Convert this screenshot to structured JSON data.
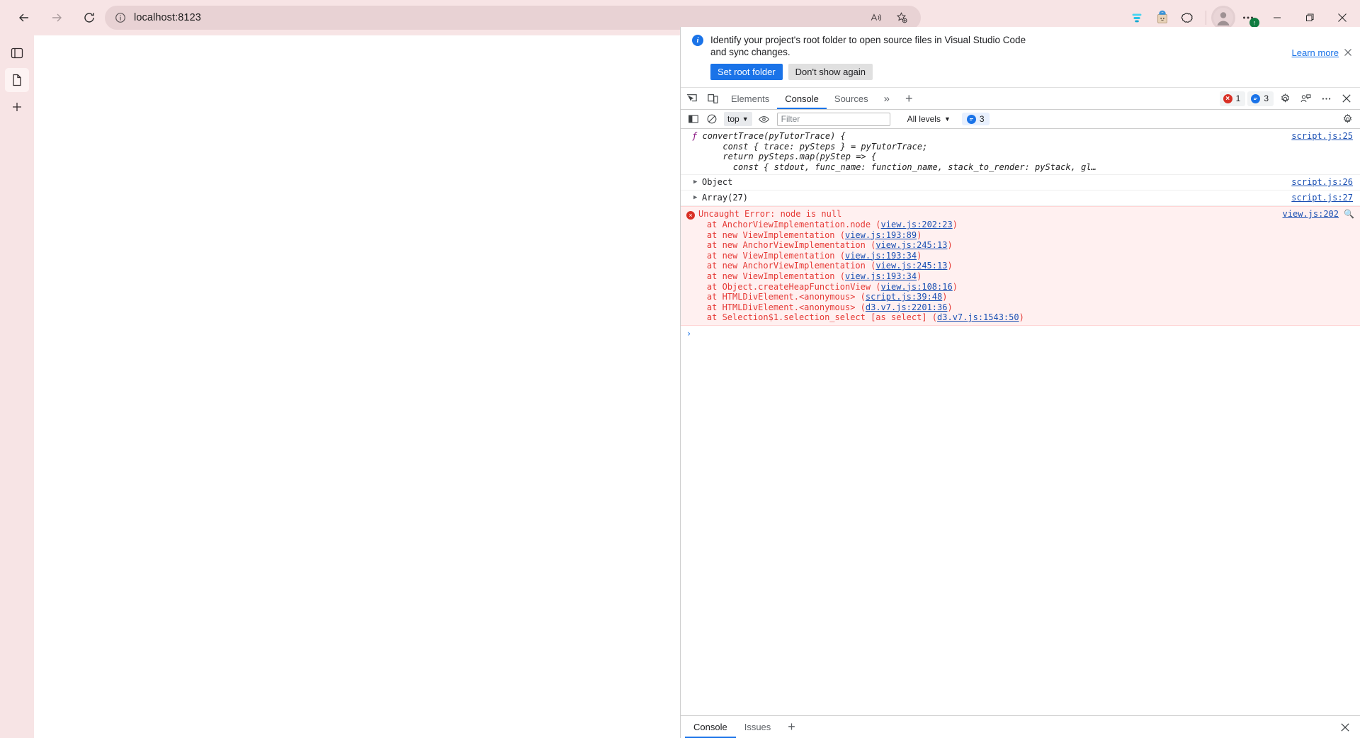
{
  "browser": {
    "back_label": "Back",
    "forward_label": "Forward",
    "refresh_label": "Refresh",
    "address": "localhost:8123",
    "info_icon": "site-info-icon",
    "read_aloud_label": "Read aloud",
    "favorite_label": "Add this page to favorites",
    "toolbar_icons": [
      {
        "name": "split-screen-icon",
        "label": "Split screen"
      },
      {
        "name": "shopping-bag-icon",
        "label": "Shopping"
      },
      {
        "name": "copilot-icon",
        "label": "Copilot"
      }
    ],
    "profile_label": "Profile",
    "settings_more_label": "Settings and more",
    "settings_badge": "↑",
    "minimize_label": "Minimize",
    "maximize_label": "Restore",
    "close_label": "Close",
    "accent": "#f7e4e5",
    "omnibox_bg": "#e8d2d4"
  },
  "left_rail": {
    "items": [
      {
        "name": "sidebar-item-copilot",
        "label": "Copilot"
      },
      {
        "name": "sidebar-item-page",
        "label": "Page",
        "active": true
      },
      {
        "name": "sidebar-item-add",
        "label": "Add tool"
      }
    ]
  },
  "devtools": {
    "infobar": {
      "icon": "info-icon",
      "text": "Identify your project's root folder to open source files in Visual Studio Code and sync changes.",
      "learn_more": "Learn more",
      "close_label": "Close",
      "primary_button": "Set root folder",
      "secondary_button": "Don't show again"
    },
    "tabbar": {
      "inspect_icon_label": "Inspect element",
      "device_icon_label": "Toggle device toolbar",
      "tabs": [
        {
          "label": "Elements",
          "active": false
        },
        {
          "label": "Console",
          "active": true
        },
        {
          "label": "Sources",
          "active": false
        }
      ],
      "more_tabs": "»",
      "add_tab": "+",
      "error_count": "1",
      "message_count": "3",
      "settings_label": "Settings",
      "feedback_label": "Send feedback",
      "more_label": "More options",
      "close_label": "Close DevTools"
    },
    "console_toolbar": {
      "sidebar_toggle_label": "Show console sidebar",
      "clear_label": "Clear console",
      "context_value": "top",
      "eye_label": "Create live expression",
      "filter_placeholder": "Filter",
      "filter_value": "",
      "levels_value": "All levels",
      "message_count": "3",
      "settings_label": "Console settings"
    },
    "logs": [
      {
        "type": "function",
        "kind_glyph": "ƒ",
        "lines": [
          "convertTrace(pyTutorTrace) {",
          "      const { trace: pySteps } = pyTutorTrace;",
          "      return pySteps.map(pyStep => {",
          "        const { stdout, func_name: function_name, stack_to_render: pyStack, gl…"
        ],
        "source": "script.js:25"
      },
      {
        "type": "object",
        "label": "Object",
        "disclosure": "▶",
        "source": "script.js:26"
      },
      {
        "type": "object",
        "label": "Array(27)",
        "disclosure": "▶",
        "source": "script.js:27"
      }
    ],
    "error": {
      "title": "Uncaught Error: node is null",
      "source": "view.js:202",
      "magnify_label": "Search for this message on the web",
      "stack": [
        {
          "text": "    at AnchorViewImplementation.node (",
          "link": "view.js:202:23",
          "suffix": ")"
        },
        {
          "text": "    at new ViewImplementation (",
          "link": "view.js:193:89",
          "suffix": ")"
        },
        {
          "text": "    at new AnchorViewImplementation (",
          "link": "view.js:245:13",
          "suffix": ")"
        },
        {
          "text": "    at new ViewImplementation (",
          "link": "view.js:193:34",
          "suffix": ")"
        },
        {
          "text": "    at new AnchorViewImplementation (",
          "link": "view.js:245:13",
          "suffix": ")"
        },
        {
          "text": "    at new ViewImplementation (",
          "link": "view.js:193:34",
          "suffix": ")"
        },
        {
          "text": "    at Object.createHeapFunctionView (",
          "link": "view.js:108:16",
          "suffix": ")"
        },
        {
          "text": "    at HTMLDivElement.<anonymous> (",
          "link": "script.js:39:48",
          "suffix": ")"
        },
        {
          "text": "    at HTMLDivElement.<anonymous> (",
          "link": "d3.v7.js:2201:36",
          "suffix": ")"
        },
        {
          "text": "    at Selection$1.selection_select [as select] (",
          "link": "d3.v7.js:1543:50",
          "suffix": ")"
        }
      ]
    },
    "prompt": {
      "caret": "›",
      "value": ""
    },
    "drawer": {
      "tabs": [
        {
          "label": "Console",
          "active": true
        },
        {
          "label": "Issues",
          "active": false
        }
      ],
      "add_label": "+",
      "close_label": "Close drawer"
    }
  }
}
